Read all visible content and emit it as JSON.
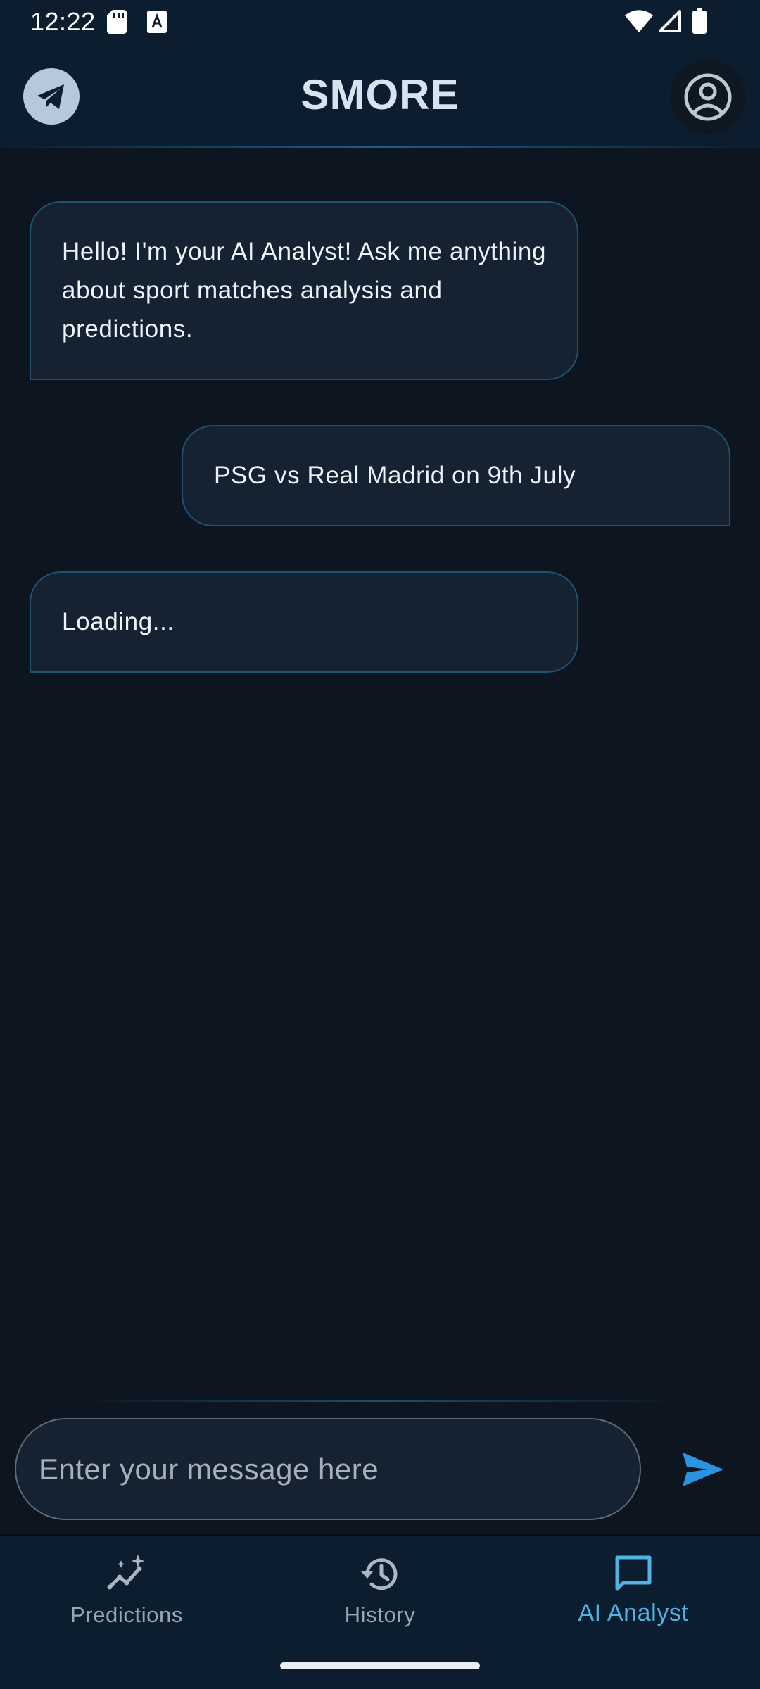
{
  "status_bar": {
    "time": "12:22"
  },
  "app_bar": {
    "title": "SMORE"
  },
  "chat": {
    "messages": [
      {
        "sender": "bot",
        "text": "Hello! I'm your AI Analyst! Ask me anything about sport matches analysis and predictions."
      },
      {
        "sender": "user",
        "text": "PSG vs Real Madrid on 9th July"
      },
      {
        "sender": "bot",
        "text": "Loading..."
      }
    ]
  },
  "composer": {
    "placeholder": "Enter your message here",
    "value": ""
  },
  "nav": {
    "items": [
      {
        "label": "Predictions",
        "icon": "predictions-icon",
        "active": false
      },
      {
        "label": "History",
        "icon": "history-icon",
        "active": false
      },
      {
        "label": "AI Analyst",
        "icon": "chat-icon",
        "active": true
      }
    ]
  },
  "colors": {
    "background": "#0d1520",
    "header": "#0b1d2e",
    "bubble": "#152232",
    "bubble_border": "#1f5273",
    "accent": "#4fb3e6",
    "send": "#2b94e0"
  }
}
